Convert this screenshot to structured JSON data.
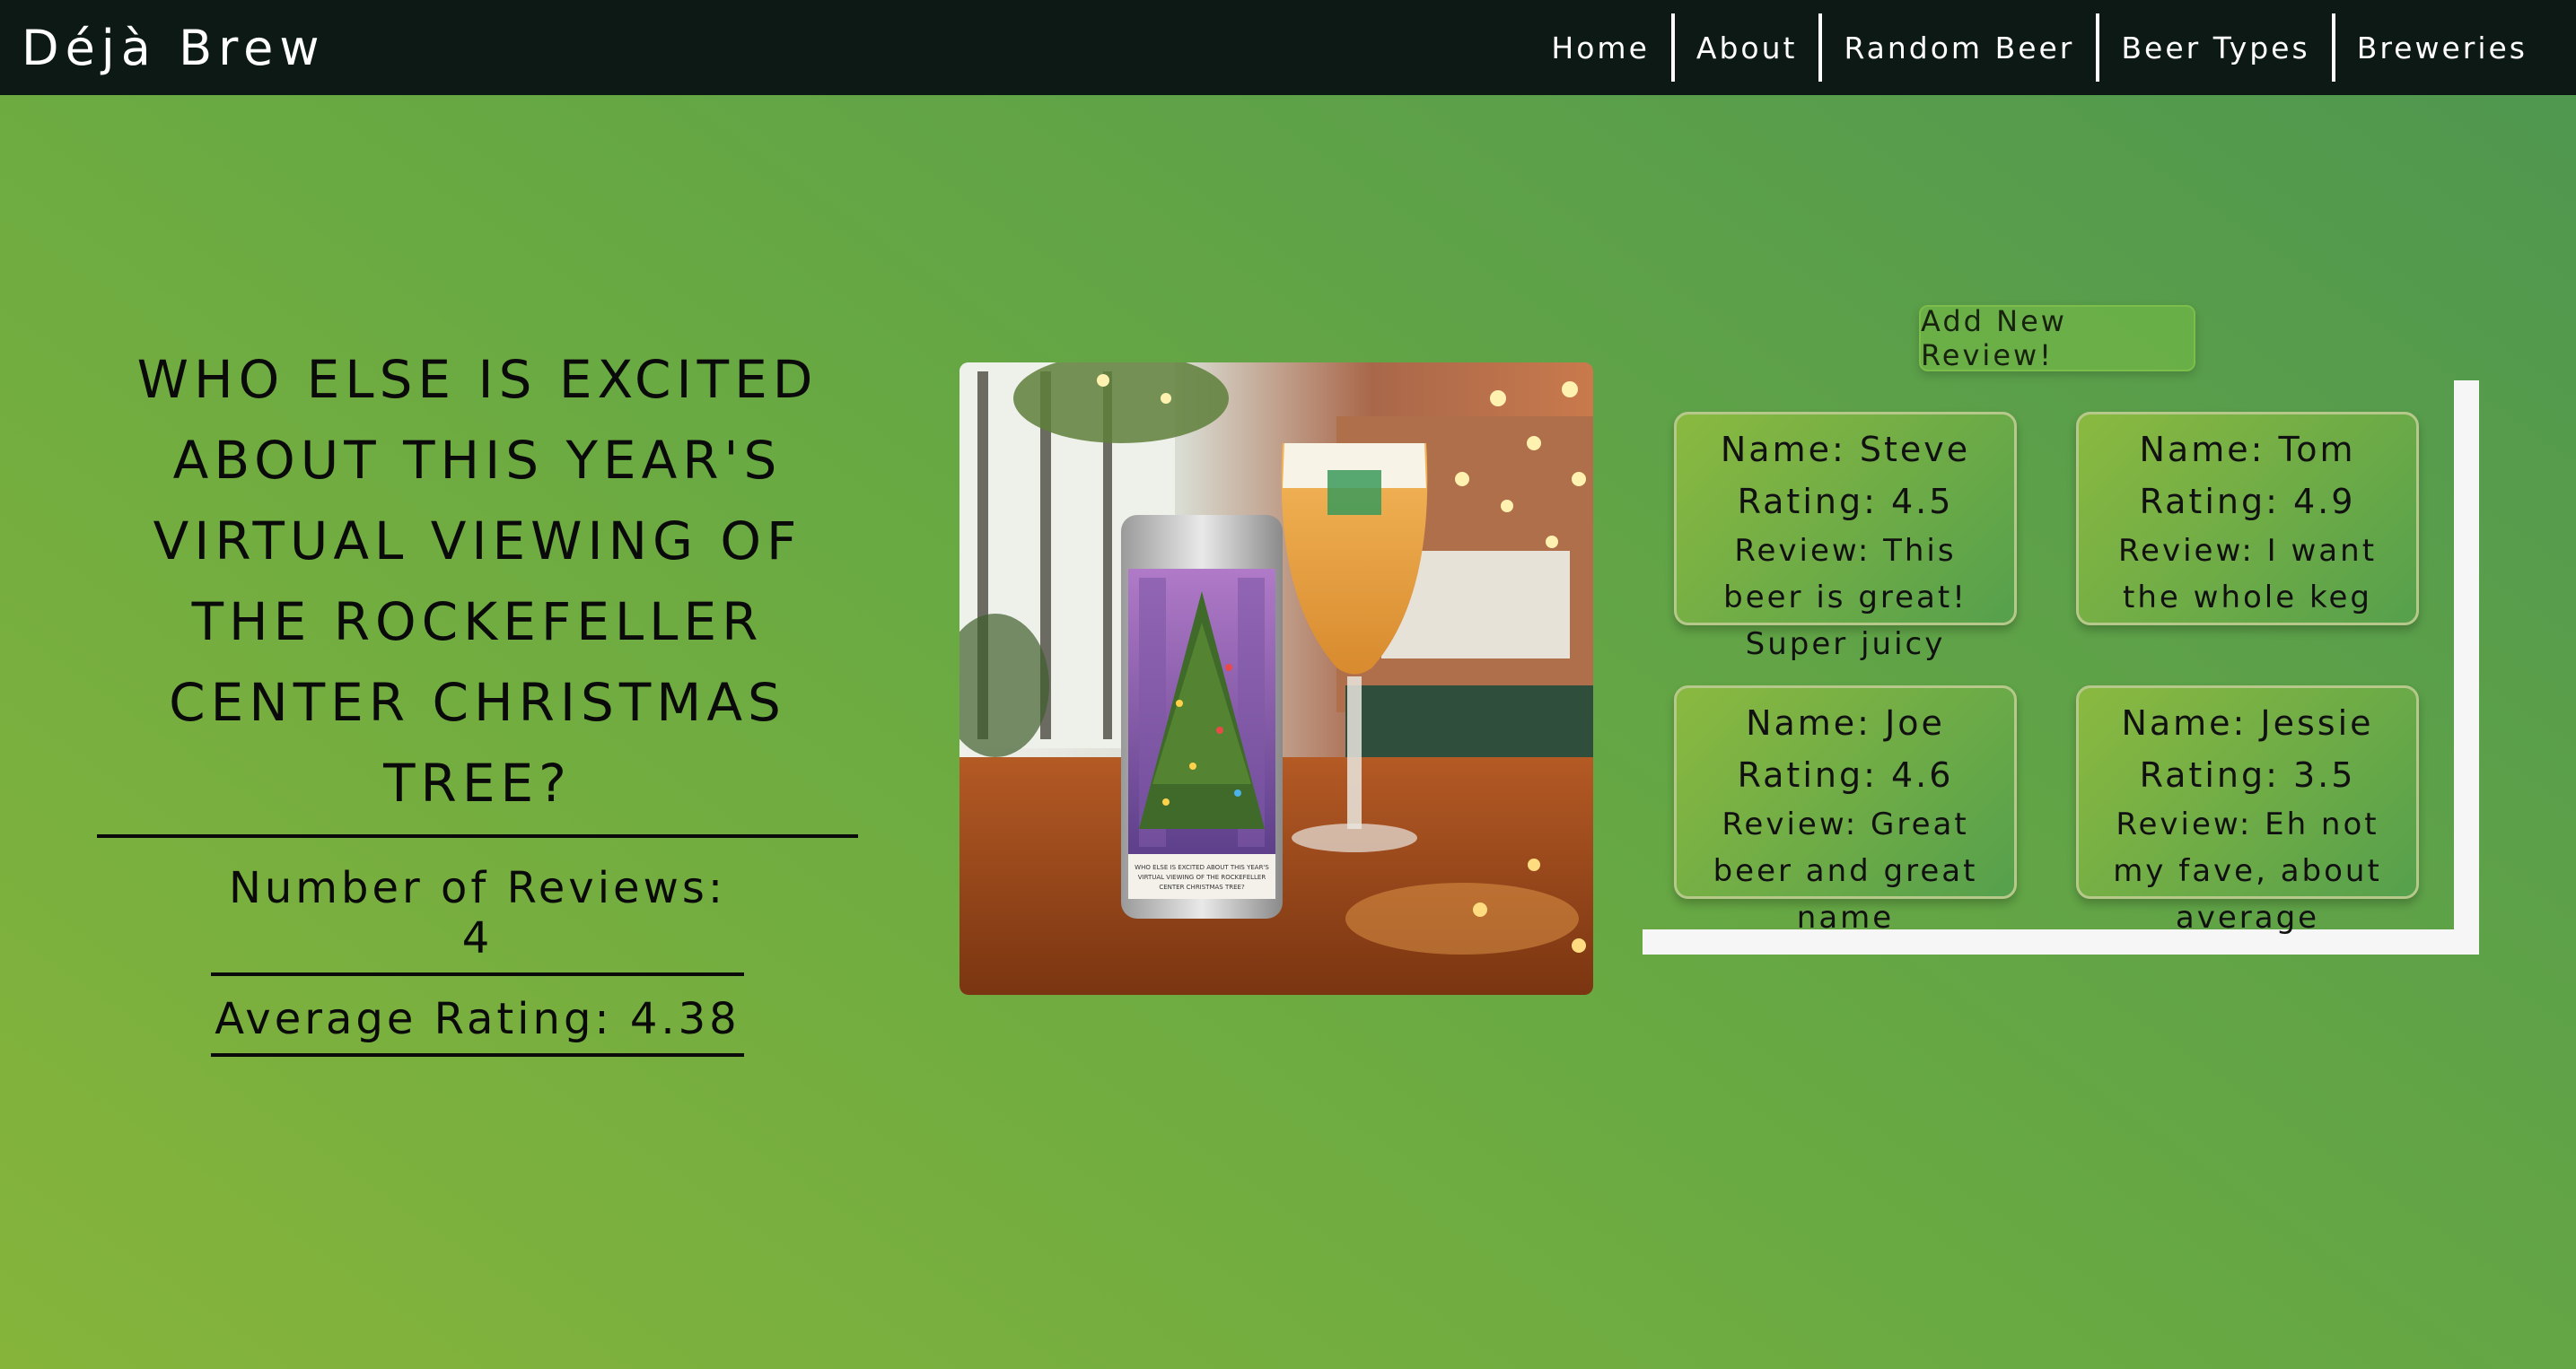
{
  "navbar": {
    "brand": "Déjà Brew",
    "links": [
      "Home",
      "About",
      "Random Beer",
      "Beer Types",
      "Breweries"
    ]
  },
  "beer": {
    "headline": "Who else is excited about this year's virtual viewing of the Rockefeller Center Christmas Tree?",
    "reviews_count_label": "Number of Reviews: 4",
    "average_rating_label": "Average Rating: 4.38",
    "can_label": "WHO ELSE IS EXCITED ABOUT THIS YEAR'S VIRTUAL VIEWING OF THE ROCKEFELLER CENTER CHRISTMAS TREE?"
  },
  "add_review_label": "Add New Review!",
  "reviews": [
    {
      "name": "Name: Steve",
      "rating": "Rating: 4.5",
      "review": "Review: This beer is great! Super juicy"
    },
    {
      "name": "Name: Tom",
      "rating": "Rating: 4.9",
      "review": "Review: I want the whole keg"
    },
    {
      "name": "Name: Joe",
      "rating": "Rating: 4.6",
      "review": "Review: Great beer and great name"
    },
    {
      "name": "Name: Jessie",
      "rating": "Rating: 3.5",
      "review": "Review: Eh not my fave, about average"
    }
  ],
  "colors": {
    "navbar_bg": "#0c1915",
    "page_gradient_start": "#86b43b",
    "page_gradient_end": "#4e9650",
    "frame": "#f6f6f6"
  }
}
